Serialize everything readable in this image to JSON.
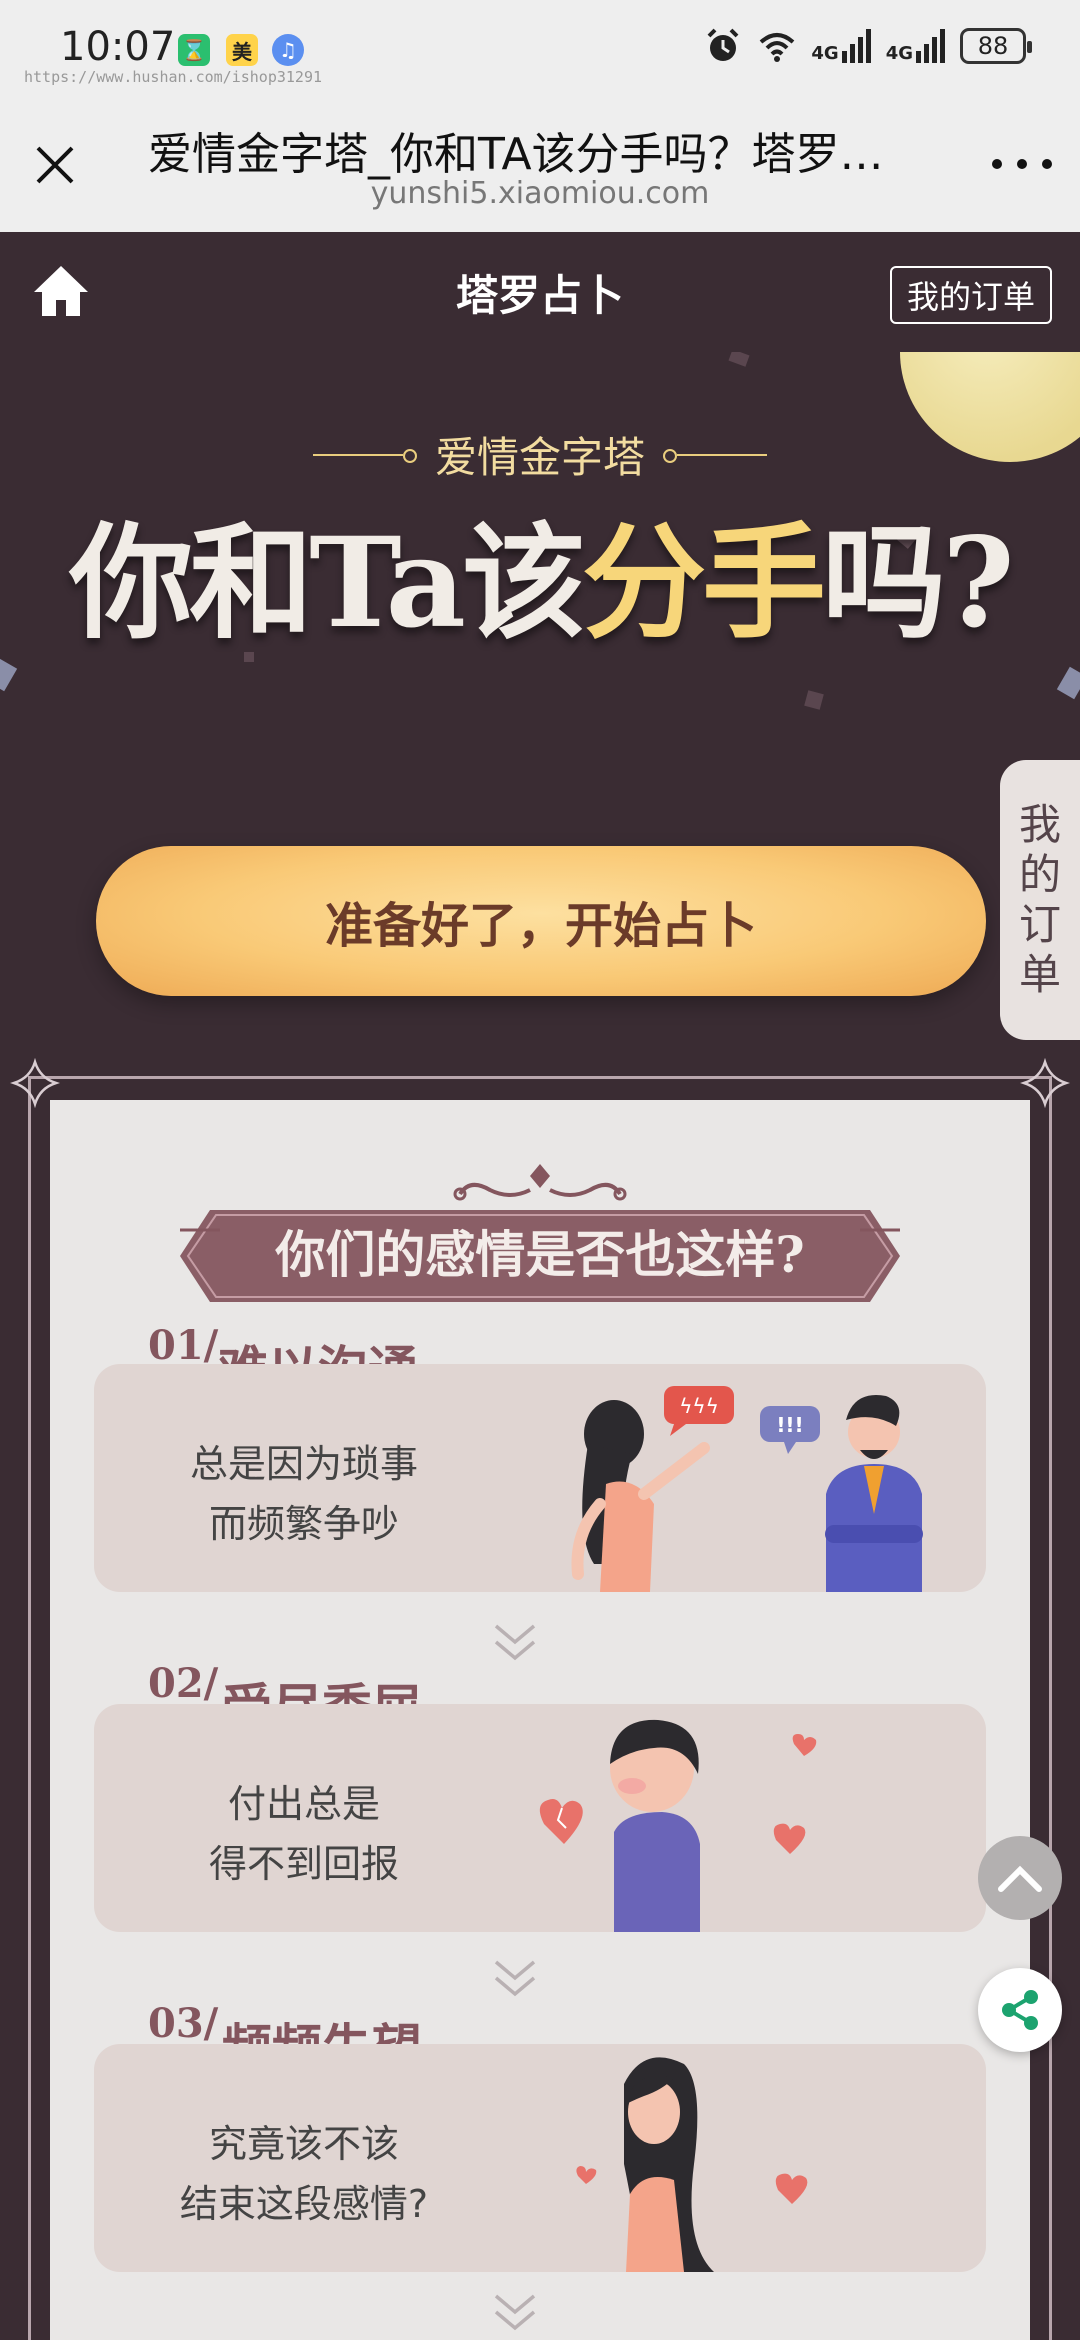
{
  "status_bar": {
    "time": "10:07",
    "watermark": "https://www.hushan.com/ishop31291",
    "battery": "88",
    "network_1": "4G",
    "network_2": "4G",
    "app_icon_2_label": "美"
  },
  "browser": {
    "title": "爱情金字塔_你和TA该分手吗？塔罗…",
    "url": "yunshi5.xiaomiou.com"
  },
  "header": {
    "title": "塔罗占卜",
    "order_button": "我的订单"
  },
  "hero": {
    "subtitle": "爱情金字塔",
    "title_part1": "你和Ta该",
    "title_highlight": "分手",
    "title_part2": "吗?",
    "start_button": "准备好了，开始占卜"
  },
  "side_tab": {
    "chars": [
      "我",
      "的",
      "订",
      "单"
    ]
  },
  "section": {
    "title": "你们的感情是否也这样?",
    "items": [
      {
        "num": "01/",
        "title": "难以沟通",
        "line1": "总是因为琐事",
        "line2": "而频繁争吵"
      },
      {
        "num": "02/",
        "title": "受尽委屈",
        "line1": "付出总是",
        "line2": "得不到回报"
      },
      {
        "num": "03/",
        "title": "频频失望",
        "line1": "究竟该不该",
        "line2": "结束这段感情?"
      }
    ],
    "bubble_1": "ϟϟϟ",
    "bubble_2": "!!!"
  },
  "colors": {
    "background": "#3a2c33",
    "accent_gold": "#f7d67a",
    "button_orange": "#f9c976",
    "title_mauve": "#84565e",
    "card_bg": "#e9e7e6"
  }
}
